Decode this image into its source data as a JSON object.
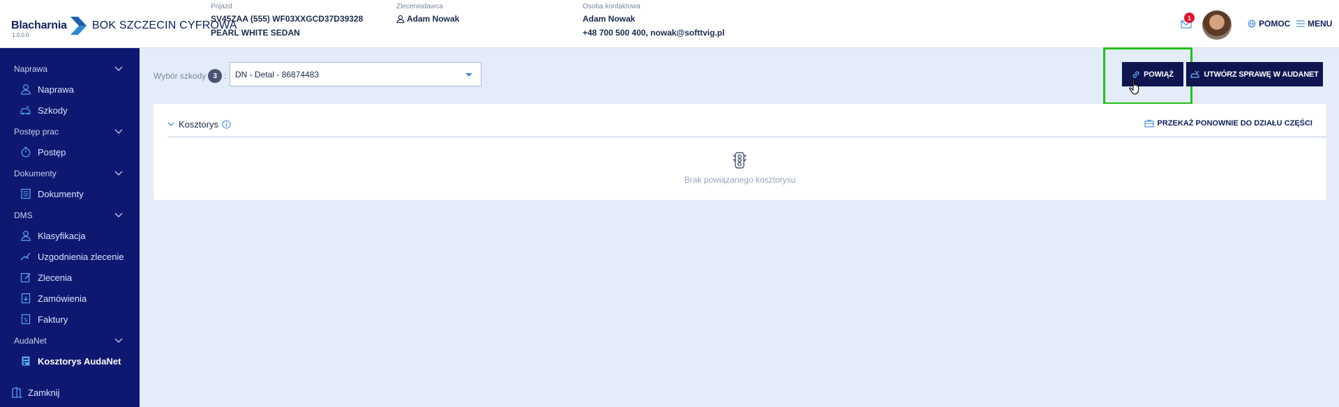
{
  "brand": {
    "name": "Blacharnia",
    "company": "BOK SZCZECIN CYFROWA",
    "version": "1.0.0.0"
  },
  "header": {
    "vehicle": {
      "label": "Pojazd",
      "line1": "SV45ZAA (555) WF03XXGCD37D39328",
      "line2": "PEARL WHITE SEDAN"
    },
    "client": {
      "label": "Zleceniodawca",
      "name": "Adam Nowak"
    },
    "contact": {
      "label": "Osoba kontaktowa",
      "name": "Adam Nowak",
      "details": "+48 700 500 400, nowak@softtvig.pl"
    },
    "notifications_count": "1",
    "help_label": "POMOC",
    "menu_label": "MENU"
  },
  "sidebar": {
    "sections": [
      {
        "label": "Naprawa",
        "items": [
          {
            "label": "Naprawa",
            "icon": "user-icon"
          },
          {
            "label": "Szkody",
            "icon": "car-damage-icon"
          }
        ]
      },
      {
        "label": "Postęp prac",
        "items": [
          {
            "label": "Postęp",
            "icon": "stopwatch-icon"
          }
        ]
      },
      {
        "label": "Dokumenty",
        "items": [
          {
            "label": "Dokumenty",
            "icon": "document-icon"
          }
        ]
      },
      {
        "label": "DMS",
        "items": [
          {
            "label": "Klasyfikacja",
            "icon": "user-icon"
          },
          {
            "label": "Uzgodnienia zlecenie",
            "icon": "handshake-icon"
          },
          {
            "label": "Zlecenia",
            "icon": "edit-icon"
          },
          {
            "label": "Zamówienia",
            "icon": "order-icon"
          },
          {
            "label": "Faktury",
            "icon": "invoice-icon"
          }
        ]
      },
      {
        "label": "AudaNet",
        "items": [
          {
            "label": "Kosztorys AudaNet",
            "icon": "estimate-icon",
            "active": true
          }
        ]
      }
    ],
    "close_label": "Zamknij"
  },
  "main": {
    "damage_label": "Wybór szkody",
    "damage_count": "3",
    "damage_separator": ":",
    "damage_selected": "DN - Detal - 86874483",
    "link_button": "POWIĄŻ",
    "create_button": "UTWÓRZ SPRAWĘ W AUDANET",
    "panel": {
      "title": "Kosztorys",
      "action": "PRZEKAŻ PONOWNIE DO DZIAŁU CZĘŚCI",
      "empty_text": "Brak powiązanego kosztorysu"
    }
  },
  "colors": {
    "sidebar": "#0f1870",
    "primary_button": "#0e1550",
    "highlight": "#22c11c",
    "background": "#e3ecf8",
    "badge": "#e3122b"
  }
}
